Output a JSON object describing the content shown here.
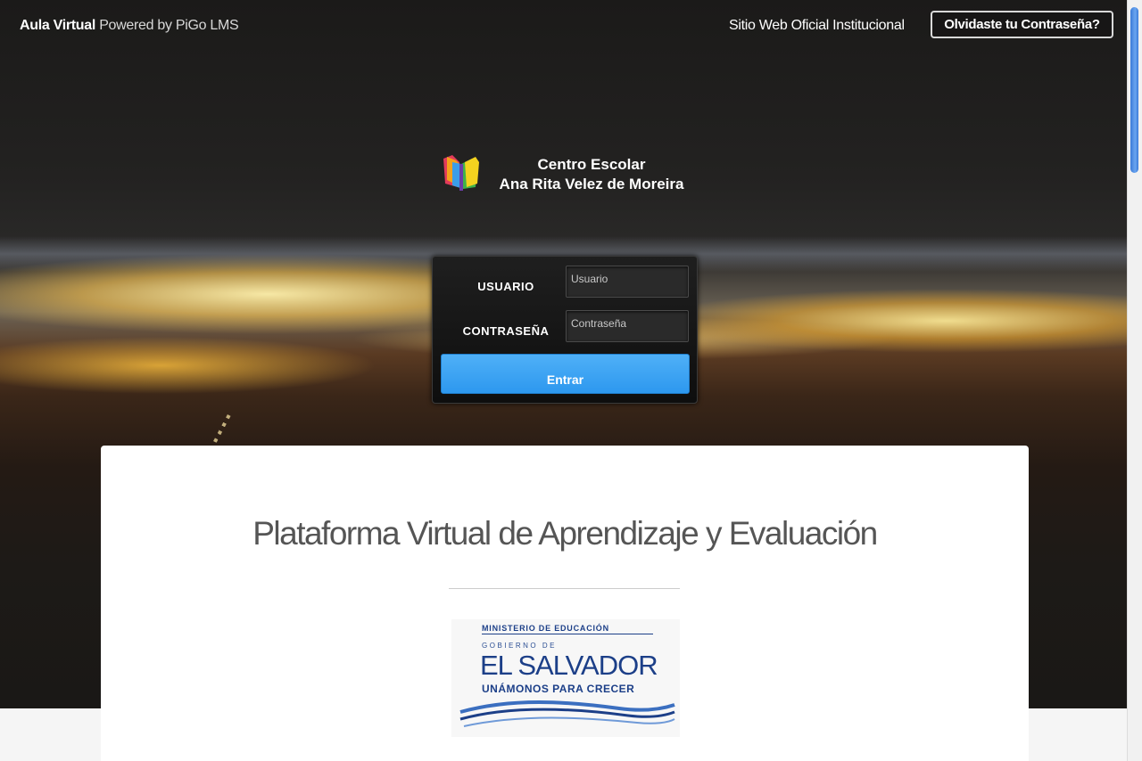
{
  "header": {
    "brand_bold": "Aula Virtual",
    "brand_rest": "Powered by PiGo LMS",
    "site_link": "Sitio Web Oficial Institucional",
    "forgot_button": "Olvidaste tu Contraseña?"
  },
  "school": {
    "line1": "Centro Escolar",
    "line2": "Ana Rita Velez de Moreira",
    "icon": "books-icon"
  },
  "login": {
    "user_label": "USUARIO",
    "user_placeholder": "Usuario",
    "pass_label": "CONTRASEÑA",
    "pass_placeholder": "Contraseña",
    "submit": "Entrar"
  },
  "content": {
    "title": "Plataforma Virtual de Aprendizaje y Evaluación",
    "ministry_logo": {
      "top": "MINISTERIO DE EDUCACIÓN",
      "gobierno": "GOBIERNO DE",
      "country": "EL SALVADOR",
      "slogan": "UNÁMONOS PARA CRECER"
    }
  },
  "colors": {
    "accent": "#2d98ef",
    "ministry_blue": "#1c3f88"
  }
}
